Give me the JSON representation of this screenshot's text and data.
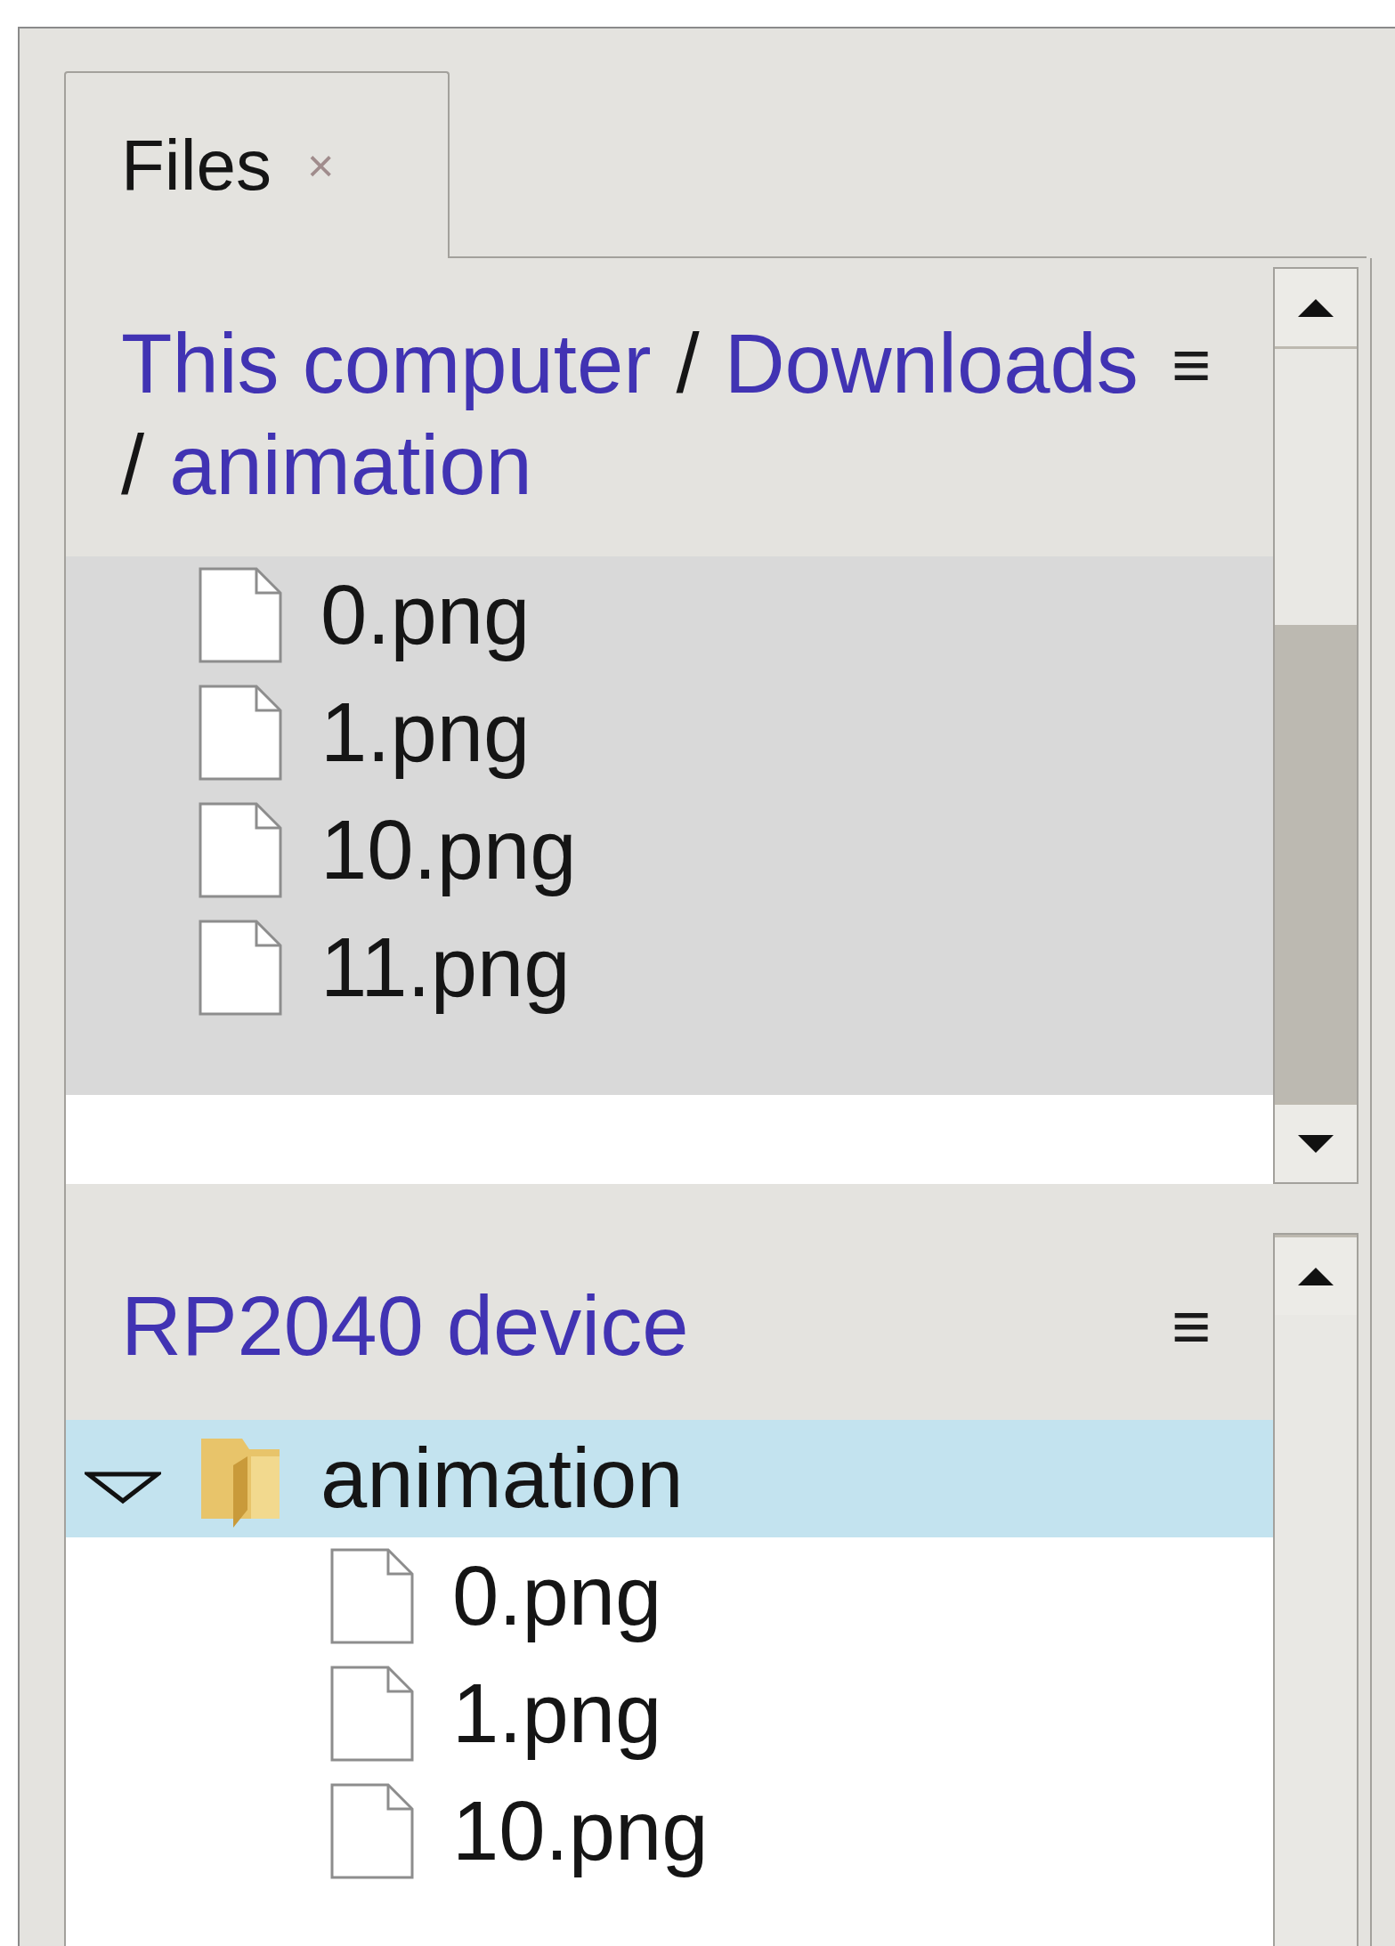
{
  "tab": {
    "label": "Files",
    "close": "×",
    "selected": true
  },
  "local": {
    "path": [
      {
        "name": "This computer"
      },
      {
        "sep": "/",
        "name": "Downloads"
      },
      {
        "sep": "/",
        "name": "animation"
      }
    ],
    "menu": "≡",
    "files": [
      {
        "name": "0.png"
      },
      {
        "name": "1.png"
      },
      {
        "name": "10.png"
      },
      {
        "name": "11.png"
      }
    ]
  },
  "device": {
    "title": "RP2040 device",
    "menu": "≡",
    "tree": [
      {
        "name": "animation",
        "kind": "folder",
        "expanded": true,
        "selected": true,
        "children": [
          {
            "name": "0.png",
            "kind": "file",
            "selected": false
          },
          {
            "name": "1.png",
            "kind": "file",
            "selected": false
          },
          {
            "name": "10.png",
            "kind": "file",
            "selected": false
          }
        ]
      }
    ]
  }
}
